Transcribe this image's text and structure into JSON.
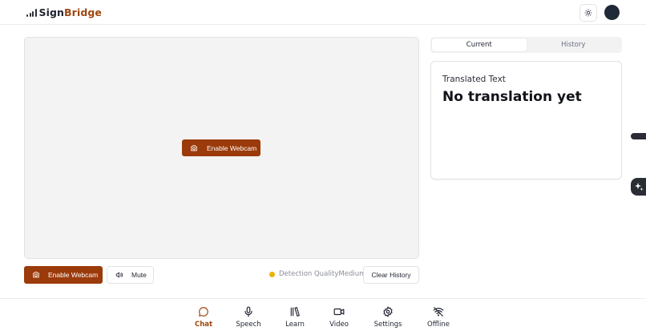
{
  "header": {
    "logo_part1": "Sign",
    "logo_part2": "Bridge",
    "theme_icon": "sun-icon",
    "avatar_color": "#1f2937"
  },
  "colors": {
    "primary": "#9b3a0a",
    "brand_accent": "#a0460f",
    "quality_indicator": "#eab308"
  },
  "video": {
    "enable_webcam_label": "Enable Webcam",
    "webcam_icon": "camera-icon"
  },
  "controls": {
    "enable_webcam_label": "Enable Webcam",
    "mute_label": "Mute",
    "mute_icon": "speaker-icon",
    "detection_quality_label": "Detection Quality",
    "detection_quality_value": "Medium",
    "clear_history_label": "Clear History"
  },
  "tabs": [
    {
      "label": "Current",
      "active": true
    },
    {
      "label": "History",
      "active": false
    }
  ],
  "translation": {
    "label": "Translated Text",
    "value": "No translation yet"
  },
  "nav": [
    {
      "label": "Chat",
      "icon": "chat-icon",
      "active": true
    },
    {
      "label": "Speech",
      "icon": "microphone-icon",
      "active": false
    },
    {
      "label": "Learn",
      "icon": "books-icon",
      "active": false
    },
    {
      "label": "Video",
      "icon": "video-icon",
      "active": false
    },
    {
      "label": "Settings",
      "icon": "gear-icon",
      "active": false
    },
    {
      "label": "Offline",
      "icon": "wifi-off-icon",
      "active": false
    }
  ]
}
